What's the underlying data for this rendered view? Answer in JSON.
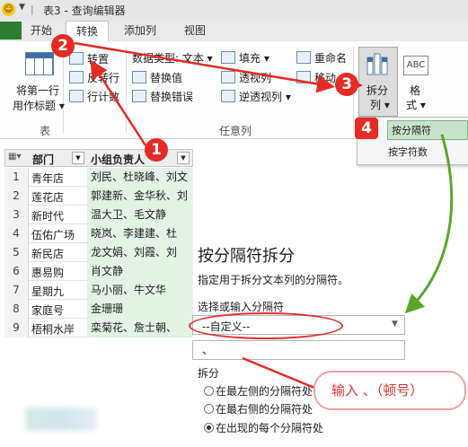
{
  "window": {
    "title": "表3 - 查询编辑器",
    "qa_arrow": "▼",
    "qa_sep": "|",
    "smiley": "☺"
  },
  "tabs": {
    "home": "开始",
    "transform": "转换",
    "add_column": "添加列",
    "view": "视图"
  },
  "ribbon": {
    "first_row_line1": "将第一行",
    "first_row_line2": "用作标题 ▾",
    "table_group": "表",
    "transpose": "转置",
    "reverse_rows": "反转行",
    "count_rows": "行计数",
    "data_type": "数据类型: 文本 ▾",
    "replace_values": "替换值",
    "replace_errors": "替换错误",
    "fill": "填充 ▾",
    "pivot": "透视列",
    "unpivot": "逆透视列 ▾",
    "rename": "重命名",
    "move": "移动 ▾",
    "any_column_group": "任意列",
    "split_line1": "拆分",
    "split_line2": "列 ▾",
    "format_line1": "格",
    "format_line2": "式 ▾",
    "format_icon": "ABC"
  },
  "split_menu": {
    "by_delimiter": "按分隔符",
    "by_char_count": "按字符数"
  },
  "grid": {
    "corner_icon": "▦▾",
    "headers": [
      "部门",
      "小组负责人"
    ],
    "dropdown": "▼",
    "rows": [
      {
        "n": "1",
        "dept": "青年店",
        "leader": "刘民、杜晓峰、刘文"
      },
      {
        "n": "2",
        "dept": "莲花店",
        "leader": "郭建新、金华秋、刘"
      },
      {
        "n": "3",
        "dept": "新时代",
        "leader": "温大卫、毛文静"
      },
      {
        "n": "4",
        "dept": "伍佑广场",
        "leader": "晓岚、李建建、杜"
      },
      {
        "n": "5",
        "dept": "新民店",
        "leader": "龙文娟、刘霞、刘"
      },
      {
        "n": "6",
        "dept": "惠易购",
        "leader": "肖文静"
      },
      {
        "n": "7",
        "dept": "星期九",
        "leader": "马小丽、牛文华"
      },
      {
        "n": "8",
        "dept": "家庭号",
        "leader": "金珊珊"
      },
      {
        "n": "9",
        "dept": "梧桐水岸",
        "leader": "栾菊花、詹士朝、"
      }
    ]
  },
  "dialog": {
    "title": "按分隔符拆分",
    "description": "指定用于拆分文本列的分隔符。",
    "select_label": "选择或输入分隔符",
    "select_value": "--自定义--",
    "select_arrow": "▼",
    "input_value": "、",
    "split_label": "拆分",
    "options": [
      "在最左侧的分隔符处",
      "在最右侧的分隔符处",
      "在出现的每个分隔符处"
    ],
    "selected_option_index": 2
  },
  "annotations": {
    "callout": "输入 、（顿号）",
    "badges": [
      "1",
      "2",
      "3",
      "4"
    ],
    "red": "#e52b24",
    "green_arrow": "#5aa62b"
  }
}
